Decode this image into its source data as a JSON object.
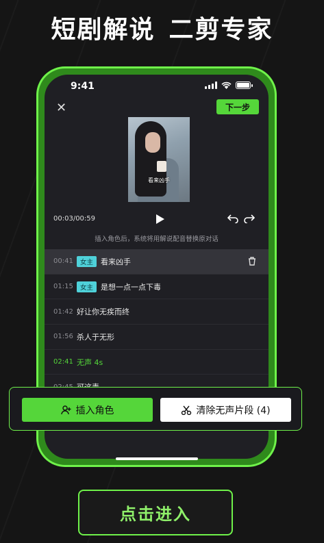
{
  "headline": {
    "left": "短剧解说",
    "right": "二剪专家"
  },
  "status": {
    "time": "9:41"
  },
  "editor": {
    "next_label": "下一步",
    "video_caption": "看来凶手",
    "timecode": "00:03/00:59",
    "hint": "插入角色后，系统将用解说配音替换原对话"
  },
  "rows": [
    {
      "time": "00:41",
      "tag": "女主",
      "text": "看来凶手"
    },
    {
      "time": "01:15",
      "tag": "女主",
      "text": "是想一点一点下毒"
    },
    {
      "time": "01:42",
      "tag": "",
      "text": "好让你无疾而终"
    },
    {
      "time": "01:56",
      "tag": "",
      "text": "杀人于无形"
    },
    {
      "time": "02:41",
      "tag": "",
      "text": "无声 4s"
    },
    {
      "time": "02:45",
      "tag": "",
      "text": "可这毒"
    }
  ],
  "actions": {
    "insert_label": "插入角色",
    "clear_label": "清除无声片段 (4)"
  },
  "cta": {
    "enter_label": "点击进入"
  },
  "colors": {
    "accent": "#55d63a",
    "tag": "#4fd1d9",
    "border": "#6ff24a"
  }
}
